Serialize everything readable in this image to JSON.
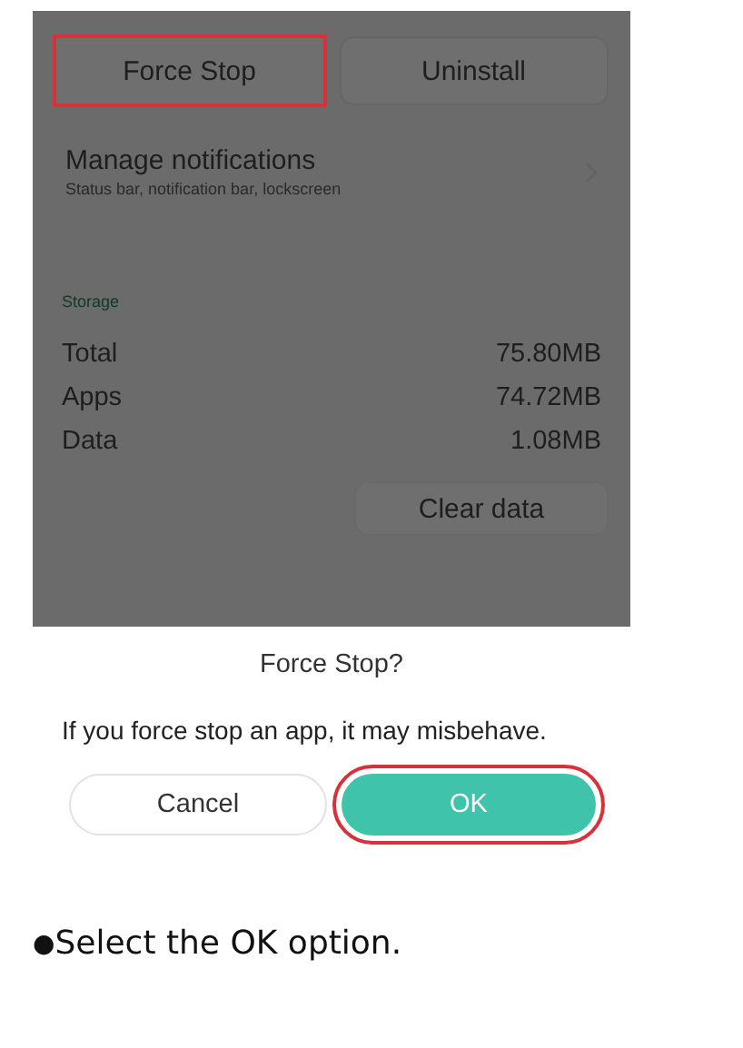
{
  "screen": {
    "action_buttons": [
      {
        "label": "Force Stop",
        "highlighted": true
      },
      {
        "label": "Uninstall",
        "highlighted": false
      }
    ],
    "notifications": {
      "title": "Manage notifications",
      "subtitle": "Status bar, notification bar, lockscreen"
    },
    "storage": {
      "heading": "Storage",
      "rows": [
        {
          "label": "Total",
          "value": "75.80MB"
        },
        {
          "label": "Apps",
          "value": "74.72MB"
        },
        {
          "label": "Data",
          "value": "1.08MB"
        }
      ],
      "button": "Clear data"
    },
    "dialog": {
      "title": "Force Stop?",
      "message": "If you force stop an app, it may misbehave.",
      "buttons": [
        {
          "label": "Cancel",
          "kind": "secondary",
          "highlighted": false
        },
        {
          "label": "OK",
          "kind": "primary",
          "highlighted": true
        }
      ]
    }
  },
  "caption": {
    "bullet": "●",
    "text": "Select the OK option."
  }
}
